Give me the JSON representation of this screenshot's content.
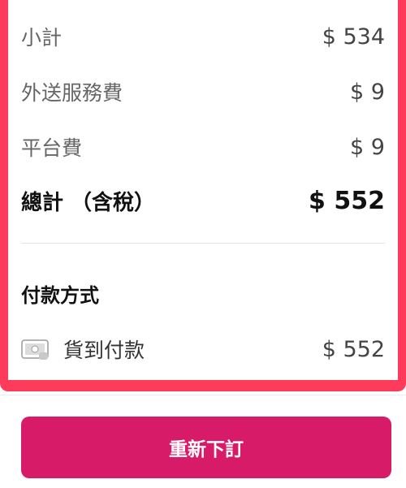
{
  "summary": {
    "subtotal_label": "小計",
    "subtotal_value": "$ 534",
    "delivery_fee_label": "外送服務費",
    "delivery_fee_value": "$ 9",
    "platform_fee_label": "平台費",
    "platform_fee_value": "$ 9",
    "total_label": "總計 （含稅）",
    "total_value": "$ 552"
  },
  "payment": {
    "section_title": "付款方式",
    "method_icon": "cash-icon",
    "method_label": "貨到付款",
    "method_amount": "$ 552"
  },
  "actions": {
    "reorder_label": "重新下訂"
  },
  "colors": {
    "highlight_frame": "#ff3b5c",
    "primary_button": "#d81b68"
  }
}
